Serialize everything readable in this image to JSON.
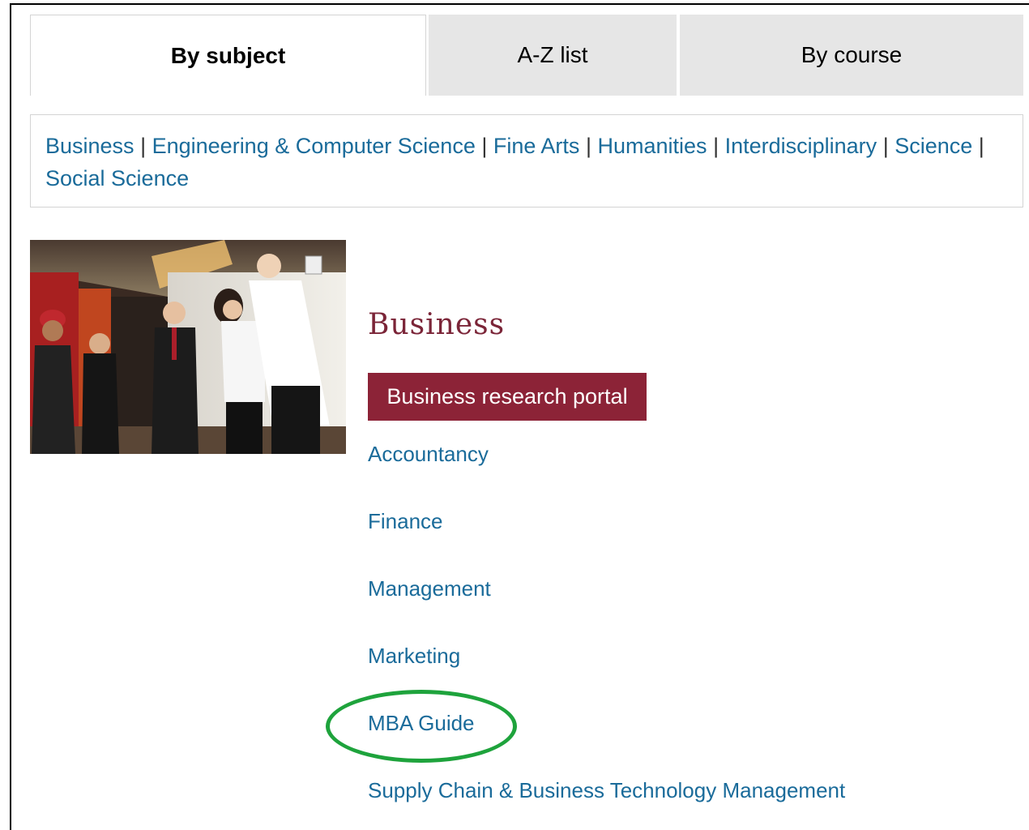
{
  "tabs": [
    {
      "label": "By subject",
      "active": true
    },
    {
      "label": "A-Z list",
      "active": false
    },
    {
      "label": "By course",
      "active": false
    }
  ],
  "subjects": [
    "Business",
    "Engineering & Computer Science",
    "Fine Arts",
    "Humanities",
    "Interdisciplinary",
    "Science",
    "Social Science"
  ],
  "separator": "|",
  "section": {
    "heading": "Business",
    "portal_button": "Business research portal",
    "links": [
      "Accountancy",
      "Finance",
      "Management",
      "Marketing",
      "MBA Guide",
      "Supply Chain & Business Technology Management"
    ]
  },
  "colors": {
    "link": "#1a6b9a",
    "heading": "#7b2538",
    "button_bg": "#8c2337",
    "highlight": "#1ea33c",
    "inactive_tab": "#e6e6e6"
  }
}
